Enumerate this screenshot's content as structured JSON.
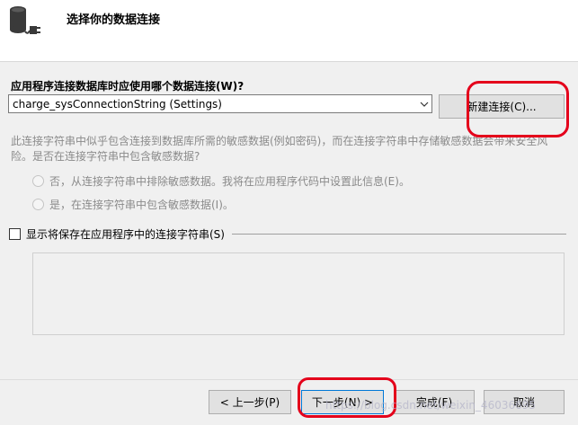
{
  "header": {
    "title": "选择你的数据连接",
    "icon": "database-plug-icon"
  },
  "connection": {
    "question": "应用程序连接数据库时应使用哪个数据连接(W)?",
    "selected": "charge_sysConnectionString (Settings)",
    "new_button": "新建连接(C)..."
  },
  "sensitive": {
    "warning": "此连接字符串中似乎包含连接到数据库所需的敏感数据(例如密码)，而在连接字符串中存储敏感数据会带来安全风险。是否在连接字符串中包含敏感数据?",
    "option_exclude": "否，从连接字符串中排除敏感数据。我将在应用程序代码中设置此信息(E)。",
    "option_include": "是，在连接字符串中包含敏感数据(I)。"
  },
  "show_string": {
    "label": "显示将保存在应用程序中的连接字符串(S)",
    "checked": false
  },
  "footer": {
    "back": "< 上一步(P)",
    "next": "下一步(N) >",
    "finish": "完成(F)",
    "cancel": "取消"
  },
  "watermark": "https://blog.csdn.net/weixin_46036695",
  "colors": {
    "annotation": "#e4001b",
    "disabled_text": "#8a8a8a",
    "focus_border": "#0078d7"
  }
}
